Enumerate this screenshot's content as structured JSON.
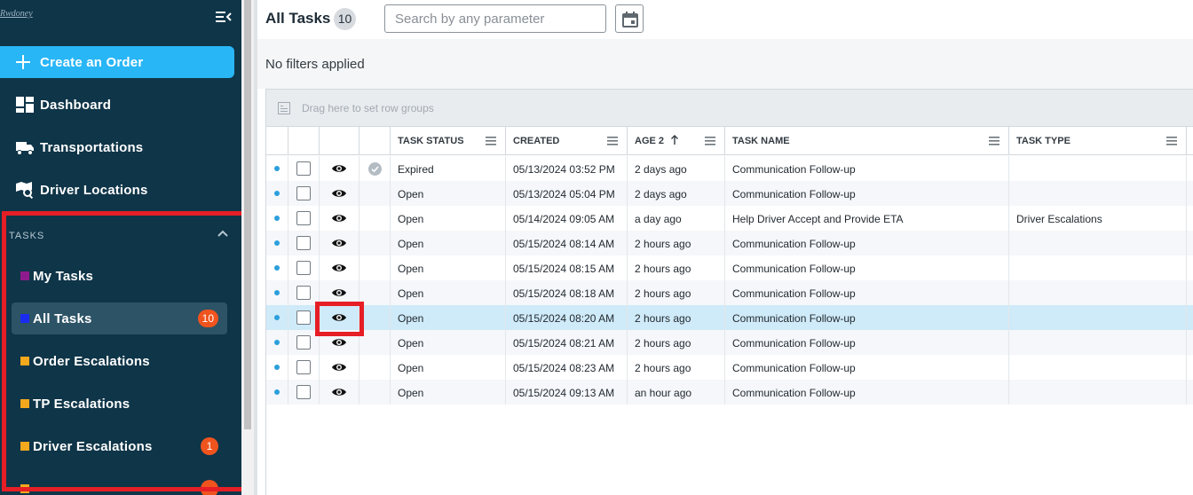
{
  "sidebar": {
    "logo_text": "Rwdoney",
    "create_label": "Create an Order",
    "nav": [
      {
        "label": "Dashboard",
        "icon": "dashboard-icon"
      },
      {
        "label": "Transportations",
        "icon": "truck-icon"
      },
      {
        "label": "Driver Locations",
        "icon": "map-search-icon"
      }
    ],
    "tasks_section": "TASKS",
    "tasks": [
      {
        "label": "My Tasks",
        "color": "#8e1b8e",
        "badge": ""
      },
      {
        "label": "All Tasks",
        "color": "#1a2cf0",
        "badge": "10",
        "active": true
      },
      {
        "label": "Order Escalations",
        "color": "#f4a81d",
        "badge": ""
      },
      {
        "label": "TP Escalations",
        "color": "#f4a81d",
        "badge": ""
      },
      {
        "label": "Driver Escalations",
        "color": "#f4a81d",
        "badge": "1"
      }
    ]
  },
  "header": {
    "title": "All Tasks",
    "count": "10",
    "search_placeholder": "Search by any parameter"
  },
  "filters": {
    "status": "No filters applied"
  },
  "grid": {
    "group_hint": "Drag here to set row groups",
    "columns": {
      "status": "TASK STATUS",
      "created": "CREATED",
      "age": "AGE 2",
      "name": "TASK NAME",
      "type": "TASK TYPE"
    },
    "rows": [
      {
        "status": "Expired",
        "created": "05/13/2024 03:52 PM",
        "age": "2 days ago",
        "name": "Communication Follow-up",
        "type": "",
        "done": true
      },
      {
        "status": "Open",
        "created": "05/13/2024 05:04 PM",
        "age": "2 days ago",
        "name": "Communication Follow-up",
        "type": ""
      },
      {
        "status": "Open",
        "created": "05/14/2024 09:05 AM",
        "age": "a day ago",
        "name": "Help Driver Accept and Provide ETA",
        "type": "Driver Escalations"
      },
      {
        "status": "Open",
        "created": "05/15/2024 08:14 AM",
        "age": "2 hours ago",
        "name": "Communication Follow-up",
        "type": ""
      },
      {
        "status": "Open",
        "created": "05/15/2024 08:15 AM",
        "age": "2 hours ago",
        "name": "Communication Follow-up",
        "type": ""
      },
      {
        "status": "Open",
        "created": "05/15/2024 08:18 AM",
        "age": "2 hours ago",
        "name": "Communication Follow-up",
        "type": ""
      },
      {
        "status": "Open",
        "created": "05/15/2024 08:20 AM",
        "age": "2 hours ago",
        "name": "Communication Follow-up",
        "type": "",
        "selected": true
      },
      {
        "status": "Open",
        "created": "05/15/2024 08:21 AM",
        "age": "2 hours ago",
        "name": "Communication Follow-up",
        "type": ""
      },
      {
        "status": "Open",
        "created": "05/15/2024 08:23 AM",
        "age": "2 hours ago",
        "name": "Communication Follow-up",
        "type": ""
      },
      {
        "status": "Open",
        "created": "05/15/2024 09:13 AM",
        "age": "an hour ago",
        "name": "Communication Follow-up",
        "type": ""
      }
    ]
  }
}
